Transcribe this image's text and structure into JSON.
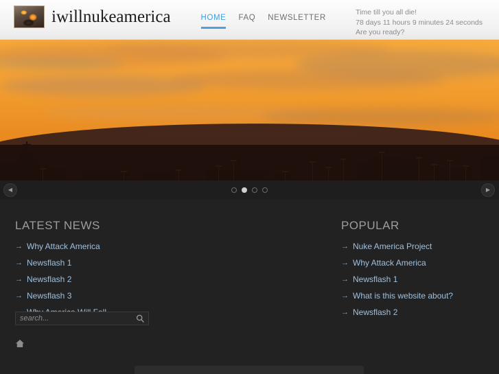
{
  "site": {
    "brand_name": "iwillnukeamerica",
    "logo_icon": "burning-coal-logo"
  },
  "nav": {
    "items": [
      {
        "label": "HOME",
        "active": true
      },
      {
        "label": "FAQ",
        "active": false
      },
      {
        "label": "NEWSLETTER",
        "active": false
      }
    ]
  },
  "countdown": {
    "line1": "Time till you all die!",
    "line2": "78 days 11 hours 9 minutes 24 seconds",
    "line3": "Are you ready?"
  },
  "slider": {
    "prev_icon": "chevron-left-icon",
    "next_icon": "chevron-right-icon",
    "prev_glyph": "◀",
    "next_glyph": "▶",
    "dots": [
      {
        "active": false
      },
      {
        "active": true
      },
      {
        "active": false
      },
      {
        "active": false
      }
    ]
  },
  "latest_news": {
    "title": "LATEST NEWS",
    "arrow": "→",
    "items": [
      {
        "label": "Why Attack America"
      },
      {
        "label": "Newsflash 1"
      },
      {
        "label": "Newsflash 2"
      },
      {
        "label": "Newsflash 3"
      },
      {
        "label": "Why America Will Fall"
      }
    ]
  },
  "popular": {
    "title": "POPULAR",
    "arrow": "→",
    "items": [
      {
        "label": "Nuke America Project"
      },
      {
        "label": "Why Attack America"
      },
      {
        "label": "Newsflash 1"
      },
      {
        "label": "What is this website about?"
      },
      {
        "label": "Newsflash 2"
      }
    ]
  },
  "search": {
    "placeholder": "search...",
    "value": "",
    "icon": "search-icon"
  },
  "footer": {
    "home_icon": "home-icon"
  },
  "colors": {
    "accent_blue": "#4aa3df",
    "link_blue": "#9fc0dd",
    "page_bg": "#222222",
    "header_bg": "#f4f4f4",
    "heading_gray": "#9d9d9d"
  }
}
